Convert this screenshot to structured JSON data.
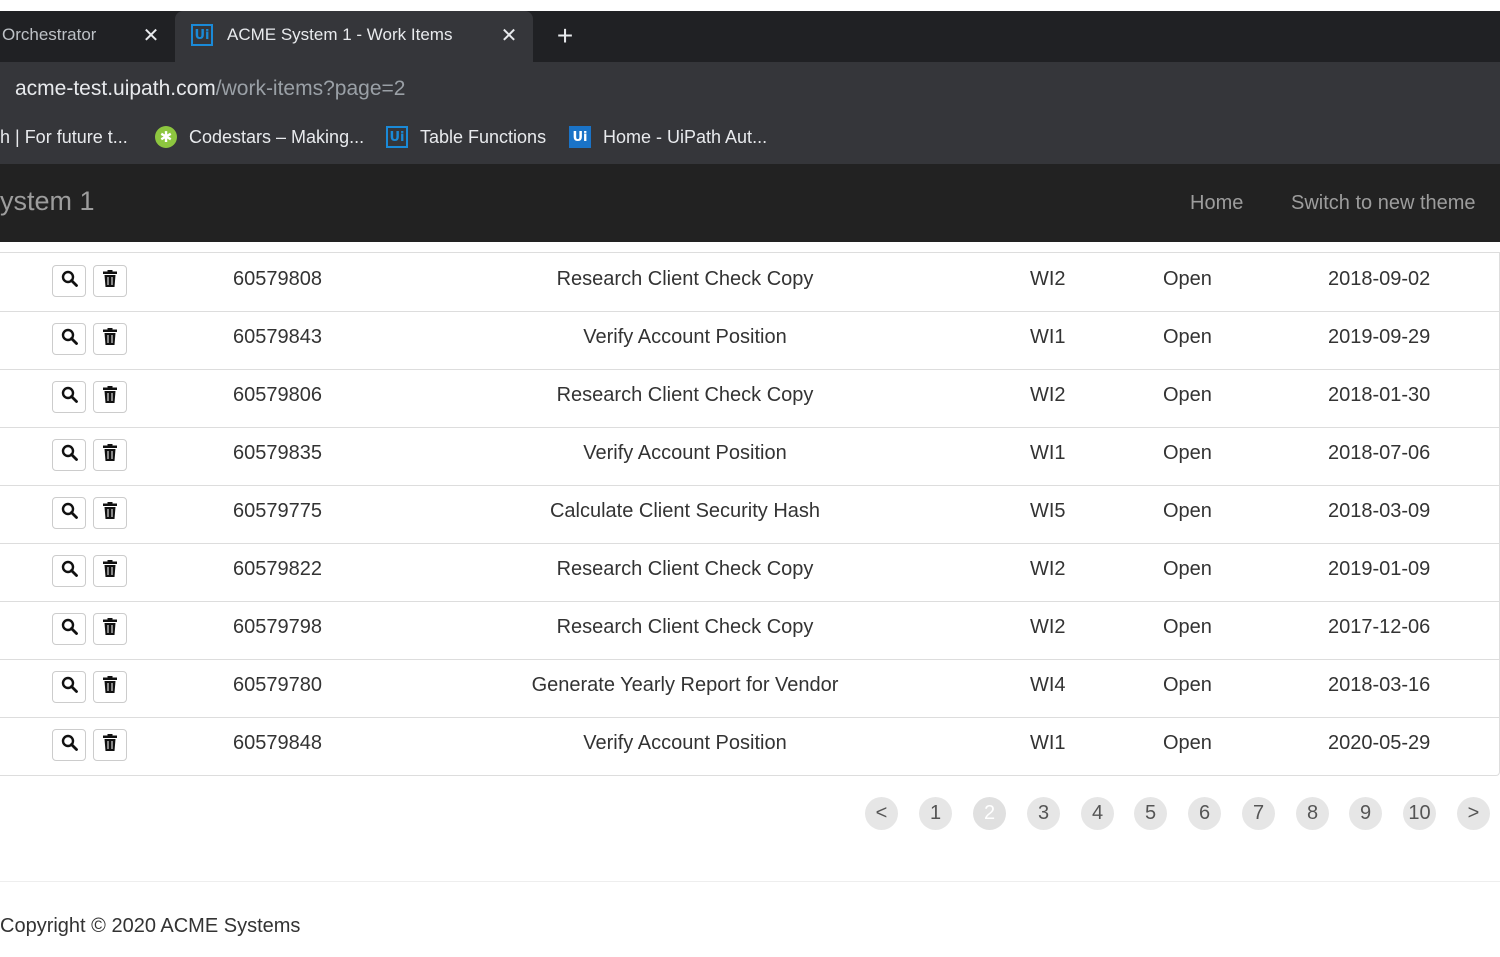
{
  "browser": {
    "tabs": [
      {
        "label": "Orchestrator",
        "active": false
      },
      {
        "label": "ACME System 1 - Work Items",
        "active": true
      }
    ],
    "address": {
      "host": "acme-test.uipath.com",
      "path": "/work-items?page=2"
    },
    "bookmarks": [
      {
        "label": "h | For future t...",
        "icon": "none"
      },
      {
        "label": "Codestars – Making...",
        "icon": "codestars-icon"
      },
      {
        "label": "Table Functions",
        "icon": "uipath-icon"
      },
      {
        "label": "Home - UiPath Aut...",
        "icon": "uipath-solid-icon"
      }
    ]
  },
  "navbar": {
    "brand": "ystem 1",
    "links": [
      "Home",
      "Switch to new theme"
    ]
  },
  "table": {
    "rows": [
      {
        "id": "60579808",
        "description": "Research Client Check Copy",
        "type": "WI2",
        "status": "Open",
        "date": "2018-09-02"
      },
      {
        "id": "60579843",
        "description": "Verify Account Position",
        "type": "WI1",
        "status": "Open",
        "date": "2019-09-29"
      },
      {
        "id": "60579806",
        "description": "Research Client Check Copy",
        "type": "WI2",
        "status": "Open",
        "date": "2018-01-30"
      },
      {
        "id": "60579835",
        "description": "Verify Account Position",
        "type": "WI1",
        "status": "Open",
        "date": "2018-07-06"
      },
      {
        "id": "60579775",
        "description": "Calculate Client Security Hash",
        "type": "WI5",
        "status": "Open",
        "date": "2018-03-09"
      },
      {
        "id": "60579822",
        "description": "Research Client Check Copy",
        "type": "WI2",
        "status": "Open",
        "date": "2019-01-09"
      },
      {
        "id": "60579798",
        "description": "Research Client Check Copy",
        "type": "WI2",
        "status": "Open",
        "date": "2017-12-06"
      },
      {
        "id": "60579780",
        "description": "Generate Yearly Report for Vendor",
        "type": "WI4",
        "status": "Open",
        "date": "2018-03-16"
      },
      {
        "id": "60579848",
        "description": "Verify Account Position",
        "type": "WI1",
        "status": "Open",
        "date": "2020-05-29"
      }
    ]
  },
  "pagination": {
    "prev": "<",
    "next": ">",
    "pages": [
      "1",
      "2",
      "3",
      "4",
      "5",
      "6",
      "7",
      "8",
      "9",
      "10"
    ],
    "current": "2"
  },
  "footer": {
    "text": "Copyright © 2020 ACME Systems"
  },
  "colors": {
    "navbar_bg": "#222222",
    "tab_bg": "#202124",
    "accent": "#1a8ad8"
  }
}
